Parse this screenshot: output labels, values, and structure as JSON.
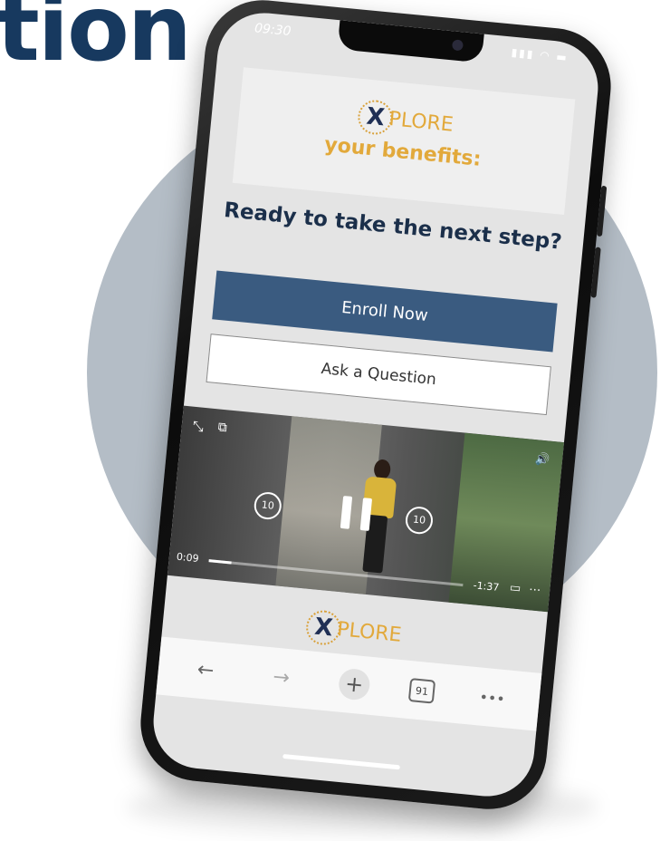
{
  "headline": {
    "text": "tion"
  },
  "status_bar": {
    "time": "09:30",
    "icons": "▮▮▮ ◠ ▬"
  },
  "hero": {
    "logo_mark": "X",
    "logo_text": "PLORE",
    "subtitle": "your benefits:"
  },
  "cta": {
    "heading": "Ready to take the next step?",
    "enroll_label": "Enroll Now",
    "ask_label": "Ask a Question"
  },
  "video": {
    "elapsed": "0:09",
    "remaining": "-1:37",
    "skip_back_label": "10",
    "skip_forward_label": "10",
    "progress_fraction": 0.09,
    "fullscreen_glyph": "⤡",
    "pip_glyph": "⧉",
    "volume_glyph": "🔊",
    "airplay_glyph": "▭",
    "more_glyph": "⋯"
  },
  "footer_logo": {
    "logo_mark": "X",
    "logo_text": "PLORE"
  },
  "browser_bar": {
    "back_glyph": "←",
    "forward_glyph": "→",
    "new_tab_glyph": "+",
    "tab_count": "91",
    "menu_glyph": "•••"
  },
  "colors": {
    "accent_navy": "#17395f",
    "primary_button": "#3a5b80",
    "logo_gold": "#e2a93b",
    "circle_bg": "#b4bdc6"
  }
}
